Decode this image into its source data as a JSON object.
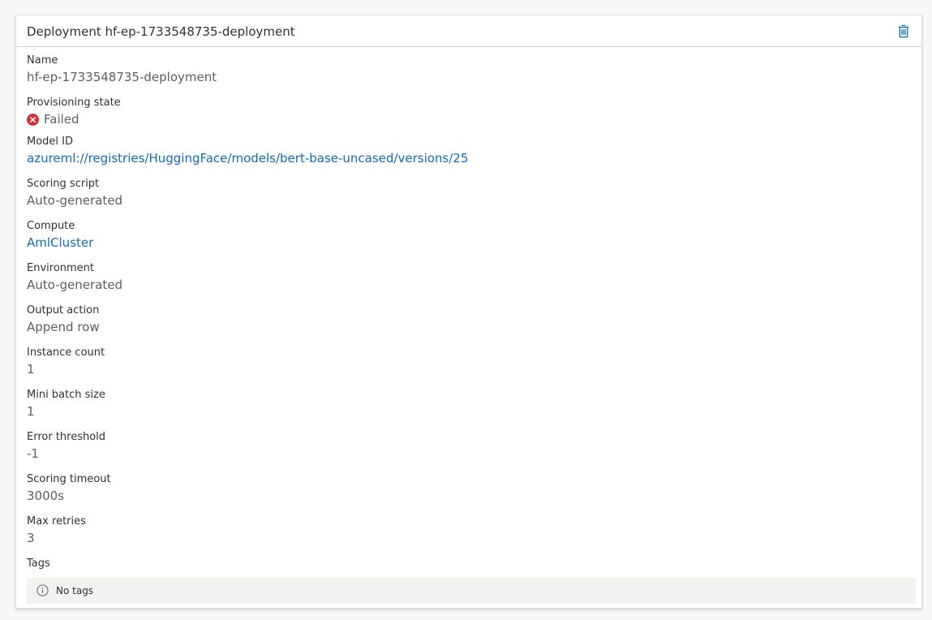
{
  "deployment": {
    "title": "Deployment hf-ep-1733548735-deployment",
    "delete_icon": "trash-icon"
  },
  "fields": {
    "name": {
      "label": "Name",
      "value": "hf-ep-1733548735-deployment"
    },
    "provisioning_state": {
      "label": "Provisioning state",
      "value": "Failed",
      "icon": "error-icon",
      "color": "#d13438"
    },
    "model_id": {
      "label": "Model ID",
      "value": "azureml://registries/HuggingFace/models/bert-base-uncased/versions/25"
    },
    "scoring_script": {
      "label": "Scoring script",
      "value": "Auto-generated"
    },
    "compute": {
      "label": "Compute",
      "value": "AmlCluster"
    },
    "environment": {
      "label": "Environment",
      "value": "Auto-generated"
    },
    "output_action": {
      "label": "Output action",
      "value": "Append row"
    },
    "instance_count": {
      "label": "Instance count",
      "value": "1"
    },
    "mini_batch_size": {
      "label": "Mini batch size",
      "value": "1"
    },
    "error_threshold": {
      "label": "Error threshold",
      "value": "-1"
    },
    "scoring_timeout": {
      "label": "Scoring timeout",
      "value": "3000s"
    },
    "max_retries": {
      "label": "Max retries",
      "value": "3"
    },
    "tags": {
      "label": "Tags",
      "empty_text": "No tags",
      "icon": "info-icon"
    }
  },
  "colors": {
    "link": "#0f6cbd",
    "error": "#d13438",
    "text_primary": "#323130",
    "text_secondary": "#605e5c"
  }
}
